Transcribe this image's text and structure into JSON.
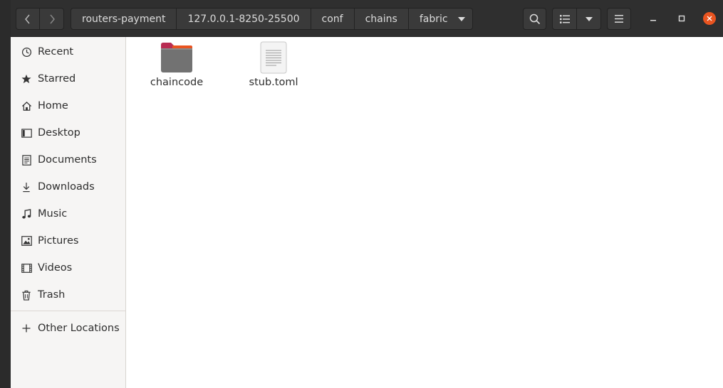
{
  "nav": {
    "back_icon": "chevron-left-icon",
    "forward_icon": "chevron-right-icon"
  },
  "breadcrumb": [
    "routers-payment",
    "127.0.0.1-8250-25500",
    "conf",
    "chains",
    "fabric"
  ],
  "toolbar": {
    "search_icon": "search-icon",
    "view_icon": "list-view-icon",
    "menu_icon": "hamburger-menu-icon"
  },
  "window_controls": {
    "close_color": "#e95420"
  },
  "sidebar": {
    "items": [
      {
        "label": "Recent",
        "icon": "clock-icon"
      },
      {
        "label": "Starred",
        "icon": "star-icon"
      },
      {
        "label": "Home",
        "icon": "home-icon"
      },
      {
        "label": "Desktop",
        "icon": "desktop-icon"
      },
      {
        "label": "Documents",
        "icon": "document-icon"
      },
      {
        "label": "Downloads",
        "icon": "download-icon"
      },
      {
        "label": "Music",
        "icon": "music-icon"
      },
      {
        "label": "Pictures",
        "icon": "picture-icon"
      },
      {
        "label": "Videos",
        "icon": "video-icon"
      },
      {
        "label": "Trash",
        "icon": "trash-icon"
      }
    ],
    "other_locations": {
      "label": "Other Locations",
      "icon": "plus-icon"
    }
  },
  "files": [
    {
      "name": "chaincode",
      "type": "folder",
      "icon": "folder-icon"
    },
    {
      "name": "stub.toml",
      "type": "text",
      "icon": "text-file-icon"
    }
  ]
}
